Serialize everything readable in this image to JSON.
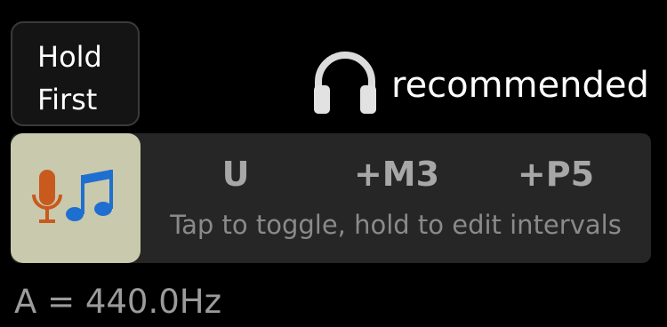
{
  "hold_button": {
    "line1": "Hold",
    "line2": "First"
  },
  "headphones": {
    "icon": "headphones-icon",
    "label": "recommended"
  },
  "panel": {
    "mic_button_icon": "mic-music-icon",
    "intervals": [
      "U",
      "+M3",
      "+P5"
    ],
    "hint": "Tap to toggle, hold to edit intervals"
  },
  "reference": {
    "text": "A = 440.0Hz"
  },
  "colors": {
    "background": "#000000",
    "panel": "#262626",
    "mic_button": "#c9c9ad",
    "note": "#1e6fd0",
    "mic": "#c85a1e"
  }
}
